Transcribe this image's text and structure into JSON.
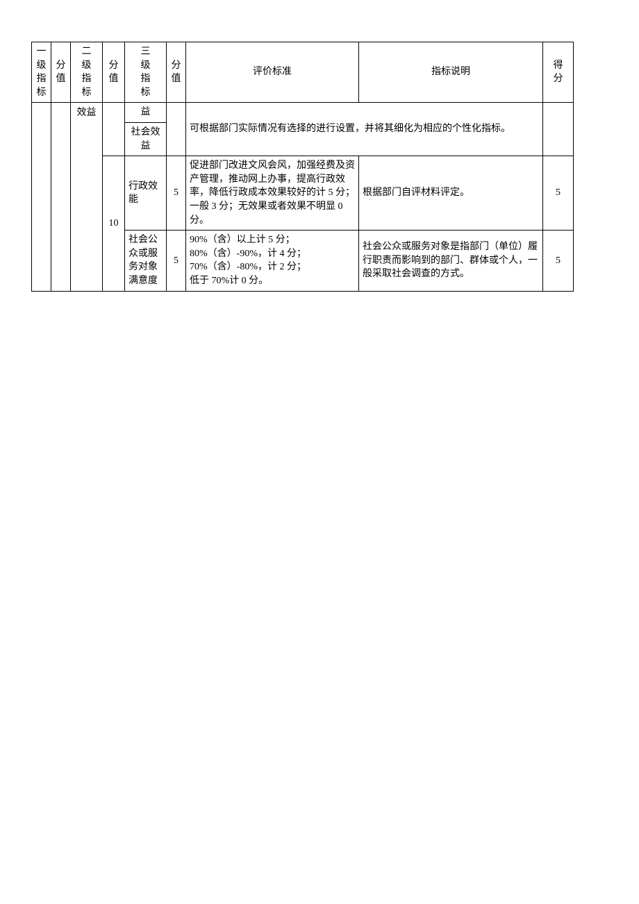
{
  "headers": {
    "level1": "一级指标",
    "score1": "分值",
    "level2": "二级指标",
    "score2": "分值",
    "level3": "三级指标",
    "score3": "分值",
    "criteria": "评价标准",
    "explanation": "指标说明",
    "result": "得分"
  },
  "row_frag1": {
    "level2": "效益",
    "level3": "益"
  },
  "row_frag2": {
    "level3": "社会效益",
    "merged_text": "可根据部门实际情况有选择的进行设置，并将其细化为相应的个性化指标。"
  },
  "row3": {
    "level3": "行政效能",
    "score3": "5",
    "criteria": "促进部门改进文风会风，加强经费及资产管理，推动网上办事，提高行政效率，降低行政成本效果较好的计 5 分；一般 3 分；无效果或者效果不明显 0 分。",
    "explanation": "根据部门自评材料评定。",
    "result": "5"
  },
  "group_score2": "10",
  "row4": {
    "level3": "社会公众或服务对象满意度",
    "score3": "5",
    "criteria": "90%（含）以上计 5 分；\n80%（含）-90%，计 4 分；\n70%（含）-80%，计 2 分；\n低于 70%计 0 分。",
    "explanation": "社会公众或服务对象是指部门（单位）履行职责而影响到的部门、群体或个人，一般采取社会调查的方式。",
    "result": "5"
  }
}
